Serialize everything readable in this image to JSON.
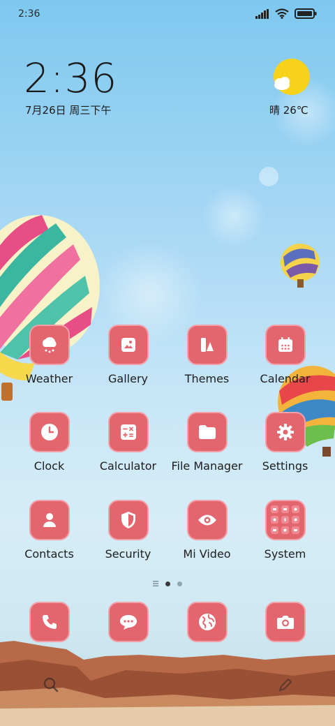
{
  "status_bar": {
    "time": "2:36"
  },
  "clock_widget": {
    "time": "2:36",
    "date": "7月26日 周三下午"
  },
  "weather_widget": {
    "text": "晴 26℃",
    "icon": "sun-cloud-icon"
  },
  "apps": [
    {
      "label": "Weather",
      "icon": "weather-cloud-icon"
    },
    {
      "label": "Gallery",
      "icon": "gallery-icon"
    },
    {
      "label": "Themes",
      "icon": "themes-icon"
    },
    {
      "label": "Calendar",
      "icon": "calendar-icon"
    },
    {
      "label": "Clock",
      "icon": "clock-icon"
    },
    {
      "label": "Calculator",
      "icon": "calculator-icon"
    },
    {
      "label": "File Manager",
      "icon": "folder-icon"
    },
    {
      "label": "Settings",
      "icon": "gear-icon"
    },
    {
      "label": "Contacts",
      "icon": "person-icon"
    },
    {
      "label": "Security",
      "icon": "shield-icon"
    },
    {
      "label": "Mi Video",
      "icon": "eye-icon"
    },
    {
      "label": "System",
      "icon": "folder-grid-icon"
    }
  ],
  "dock": [
    {
      "icon": "phone-icon"
    },
    {
      "icon": "message-icon"
    },
    {
      "icon": "globe-icon"
    },
    {
      "icon": "camera-icon"
    }
  ],
  "colors": {
    "tile": "#e3666f",
    "tile_border": "#f3a0a8"
  }
}
